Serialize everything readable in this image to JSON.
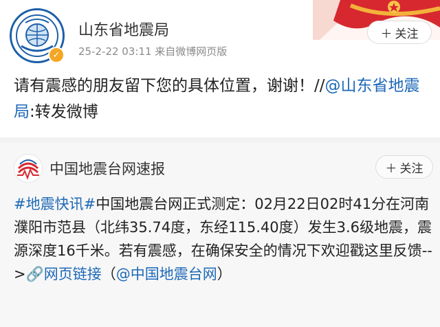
{
  "post1": {
    "account_name": "山东省地震局",
    "meta": "25-2-22 03:11  来自微博网页版",
    "follow_label": "关注",
    "text_main": "请有震感的朋友留下您的具体位置，谢谢！//",
    "text_mention": "@山东省地震局",
    "text_tail": ":转发微博"
  },
  "post2": {
    "account_name": "中国地震台网速报",
    "follow_label": "关注",
    "hashtag": "#地震快讯#",
    "body": "中国地震台网正式测定：02月22日02时41分在河南濮阳市范县（北纬35.74度，东经115.40度）发生3.6级地震，震源深度16千米。若有震感，在确保安全的情况下欢迎戳这里反馈-->",
    "link_label": "网页链接",
    "paren_open": "（",
    "mention": "@中国地震台网",
    "paren_close": "）"
  },
  "colors": {
    "link": "#1c68b8",
    "verified_badge": "#f5a623",
    "banner_red": "#d7282f"
  },
  "icons": [
    "verified-badge-icon",
    "plus-icon",
    "link-icon"
  ]
}
